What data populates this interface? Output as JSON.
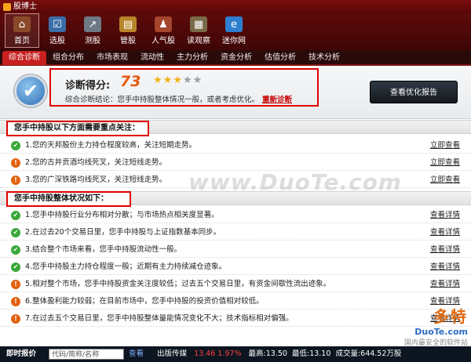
{
  "window": {
    "title": "股博士"
  },
  "toolbar": {
    "items": [
      {
        "label": "首页",
        "icon": "home-icon",
        "glyph": "⌂",
        "color": "#8a4a2a",
        "active": true
      },
      {
        "label": "选股",
        "icon": "stock-select-icon",
        "glyph": "☑",
        "color": "#3a6ea8",
        "active": false
      },
      {
        "label": "测股",
        "icon": "chart-test-icon",
        "glyph": "↗",
        "color": "#6e7a86",
        "active": false
      },
      {
        "label": "管股",
        "icon": "manage-icon",
        "glyph": "▤",
        "color": "#b8862a",
        "active": false
      },
      {
        "label": "人气股",
        "icon": "popularity-icon",
        "glyph": "♟",
        "color": "#a4452c",
        "active": false
      },
      {
        "label": "读观察",
        "icon": "read-icon",
        "glyph": "▦",
        "color": "#7a6a4a",
        "active": false
      },
      {
        "label": "迷你网",
        "icon": "browser-icon",
        "glyph": "e",
        "color": "#2f7fd0",
        "active": false
      }
    ]
  },
  "tabs": [
    "综合诊断",
    "组合分布",
    "市场表现",
    "流动性",
    "主力分析",
    "资金分析",
    "估值分析",
    "技术分析"
  ],
  "summary": {
    "score_label": "诊断得分:",
    "score": "73",
    "stars_filled": 3,
    "stars_total": 5,
    "conclusion": "综合诊断结论：您手中持股整体情况一般，或者考虑优化。",
    "rediagnose": "重新诊断",
    "report_button": "查看优化报告"
  },
  "section1": {
    "title": "您手中持股以下方面需要重点关注：",
    "rows": [
      {
        "status": "ok",
        "text": "1.您的天邦股份主力持仓程度较高，关注短期走势。",
        "link": "立即查看"
      },
      {
        "status": "warn",
        "text": "2.您的古井贡酒均线死叉，关注短线走势。",
        "link": "立即查看"
      },
      {
        "status": "warn",
        "text": "3.您的广深铁路均线死叉，关注短线走势。",
        "link": "立即查看"
      }
    ]
  },
  "section2": {
    "title": "您手中持股整体状况如下：",
    "rows": [
      {
        "status": "ok",
        "text": "1.您手中持股行业分布相对分散；与市场热点相关度显著。",
        "link": "查看详情"
      },
      {
        "status": "ok",
        "text": "2.在过去20个交易日里，您手中持股与上证指数基本同步。",
        "link": "查看详情"
      },
      {
        "status": "ok",
        "text": "3.结合整个市场来看，您手中持股流动性一般。",
        "link": "查看详情"
      },
      {
        "status": "ok",
        "text": "4.您手中持股主力持仓程度一般；近期有主力持续减仓迹象。",
        "link": "查看详情"
      },
      {
        "status": "warn",
        "text": "5.相对整个市场，您手中持股资金关注度较低；过去五个交易日里，有资金间歇性流出迹象。",
        "link": "查看详情"
      },
      {
        "status": "warn",
        "text": "6.整体盈利能力较弱；在目前市场中，您手中持股的投资价值相对较低。",
        "link": "查看详情"
      },
      {
        "status": "warn",
        "text": "7.在过去五个交易日里，您手中持股整体量能情况变化不大；技术指标相对偏强。",
        "link": "查看详情"
      }
    ]
  },
  "watermark": {
    "main": "www.DuoTe.com",
    "brand": "多特",
    "brand_url": "DuoTe.com",
    "brand_slogan": "国内最安全的软件站"
  },
  "statusbar": {
    "label": "即时报价",
    "input_placeholder": "代码/简称/名称",
    "view": "查看",
    "stock": "出版传媒",
    "price_change": "13.46 1.97%",
    "high": "最高:13.50",
    "low": "最低:13.10",
    "volume": "成交量:644.52万股"
  }
}
